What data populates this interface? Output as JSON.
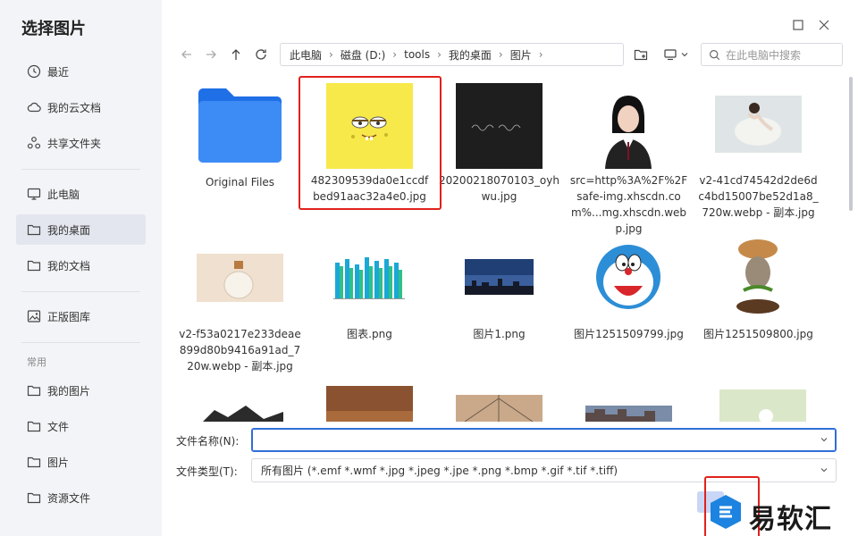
{
  "sidebar": {
    "title": "选择图片",
    "items": [
      {
        "label": "最近",
        "icon": "clock-icon"
      },
      {
        "label": "我的云文档",
        "icon": "cloud-icon"
      },
      {
        "label": "共享文件夹",
        "icon": "share-icon"
      },
      {
        "label": "此电脑",
        "icon": "monitor-icon"
      },
      {
        "label": "我的桌面",
        "icon": "folder-icon"
      },
      {
        "label": "我的文档",
        "icon": "folder-icon"
      },
      {
        "label": "正版图库",
        "icon": "image-library-icon"
      },
      {
        "label": "我的图片",
        "icon": "folder-icon"
      },
      {
        "label": "文件",
        "icon": "folder-icon"
      },
      {
        "label": "图片",
        "icon": "folder-icon"
      },
      {
        "label": "资源文件",
        "icon": "folder-icon"
      }
    ],
    "section_label": "常用"
  },
  "breadcrumb": [
    "此电脑",
    "磁盘 (D:)",
    "tools",
    "我的桌面",
    "图片"
  ],
  "search": {
    "placeholder": "在此电脑中搜索"
  },
  "files": [
    {
      "name": "Original Files",
      "kind": "folder"
    },
    {
      "name": "482309539da0e1ccdfbed91aac32a4e0.jpg",
      "kind": "image"
    },
    {
      "name": "20200218070103_oyhwu.jpg",
      "kind": "image"
    },
    {
      "name": "src=http%3A%2F%2Fsafe-img.xhscdn.com%...mg.xhscdn.webp.jpg",
      "kind": "image"
    },
    {
      "name": "v2-41cd74542d2de6dc4bd15007be52d1a8_720w.webp - 副本.jpg",
      "kind": "image"
    },
    {
      "name": "v2-f53a0217e233deae899d80b9416a91ad_720w.webp - 副本.jpg",
      "kind": "image"
    },
    {
      "name": "图表.png",
      "kind": "image"
    },
    {
      "name": "图片1.png",
      "kind": "image"
    },
    {
      "name": "图片1251509799.jpg",
      "kind": "image"
    },
    {
      "name": "图片1251509800.jpg",
      "kind": "image"
    }
  ],
  "bottom": {
    "filename_label": "文件名称(N):",
    "filename_value": "",
    "filetype_label": "文件类型(T):",
    "filetype_value": "所有图片 (*.emf *.wmf *.jpg *.jpeg *.jpe *.png *.bmp *.gif *.tif *.tiff)"
  },
  "watermark": {
    "text": "易软汇"
  },
  "colors": {
    "accent": "#2f6fd6",
    "highlight": "#e0211c",
    "folder": "#2f7ff0"
  }
}
